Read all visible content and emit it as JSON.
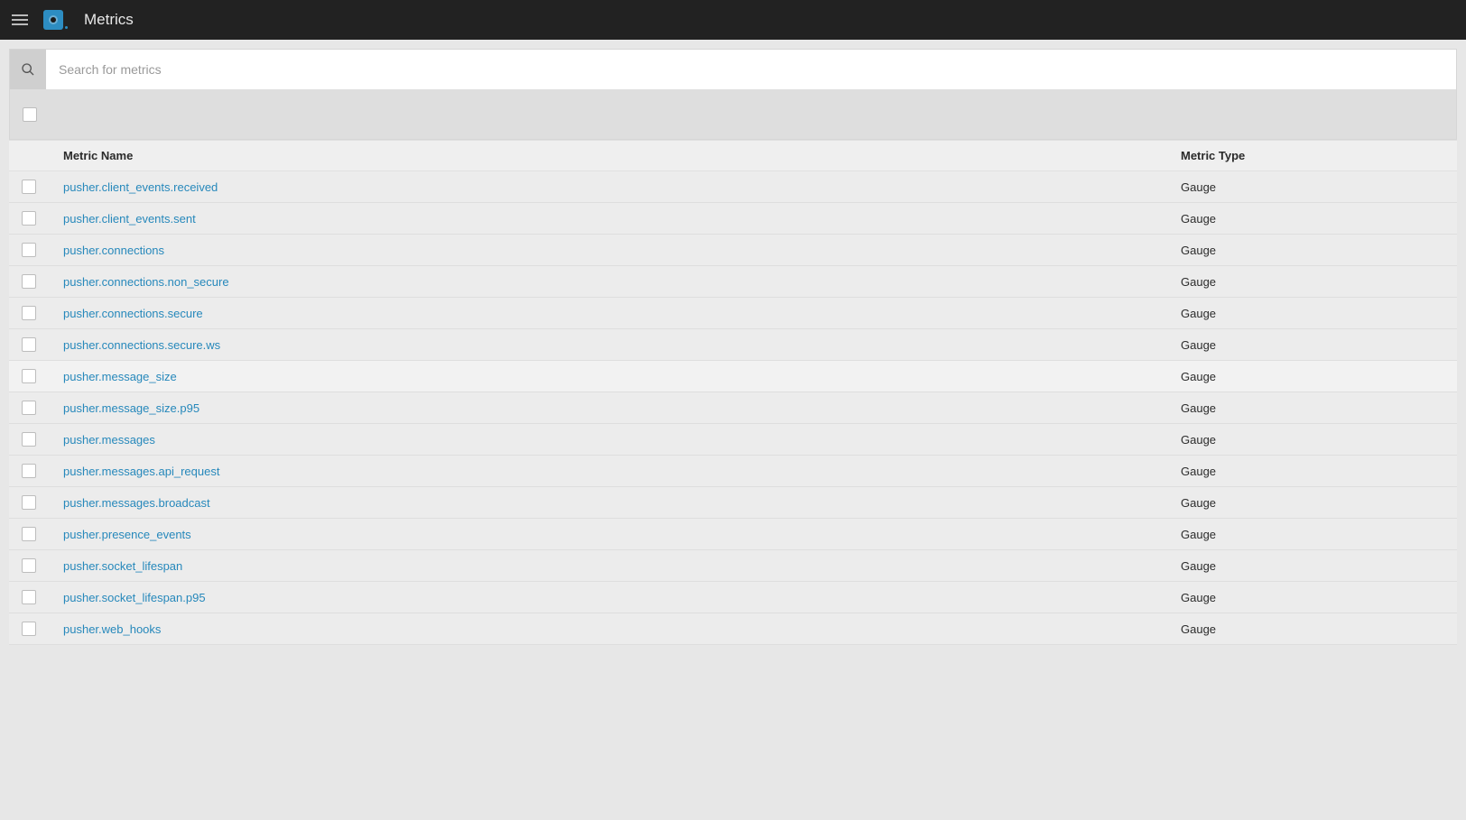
{
  "header": {
    "title": "Metrics"
  },
  "search": {
    "placeholder": "Search for metrics",
    "value": ""
  },
  "table": {
    "columns": {
      "name": "Metric Name",
      "type": "Metric Type"
    },
    "rows": [
      {
        "name": "pusher.client_events.received",
        "type": "Gauge"
      },
      {
        "name": "pusher.client_events.sent",
        "type": "Gauge"
      },
      {
        "name": "pusher.connections",
        "type": "Gauge"
      },
      {
        "name": "pusher.connections.non_secure",
        "type": "Gauge"
      },
      {
        "name": "pusher.connections.secure",
        "type": "Gauge"
      },
      {
        "name": "pusher.connections.secure.ws",
        "type": "Gauge"
      },
      {
        "name": "pusher.message_size",
        "type": "Gauge",
        "hovered": true
      },
      {
        "name": "pusher.message_size.p95",
        "type": "Gauge"
      },
      {
        "name": "pusher.messages",
        "type": "Gauge"
      },
      {
        "name": "pusher.messages.api_request",
        "type": "Gauge"
      },
      {
        "name": "pusher.messages.broadcast",
        "type": "Gauge"
      },
      {
        "name": "pusher.presence_events",
        "type": "Gauge"
      },
      {
        "name": "pusher.socket_lifespan",
        "type": "Gauge"
      },
      {
        "name": "pusher.socket_lifespan.p95",
        "type": "Gauge"
      },
      {
        "name": "pusher.web_hooks",
        "type": "Gauge"
      }
    ]
  }
}
